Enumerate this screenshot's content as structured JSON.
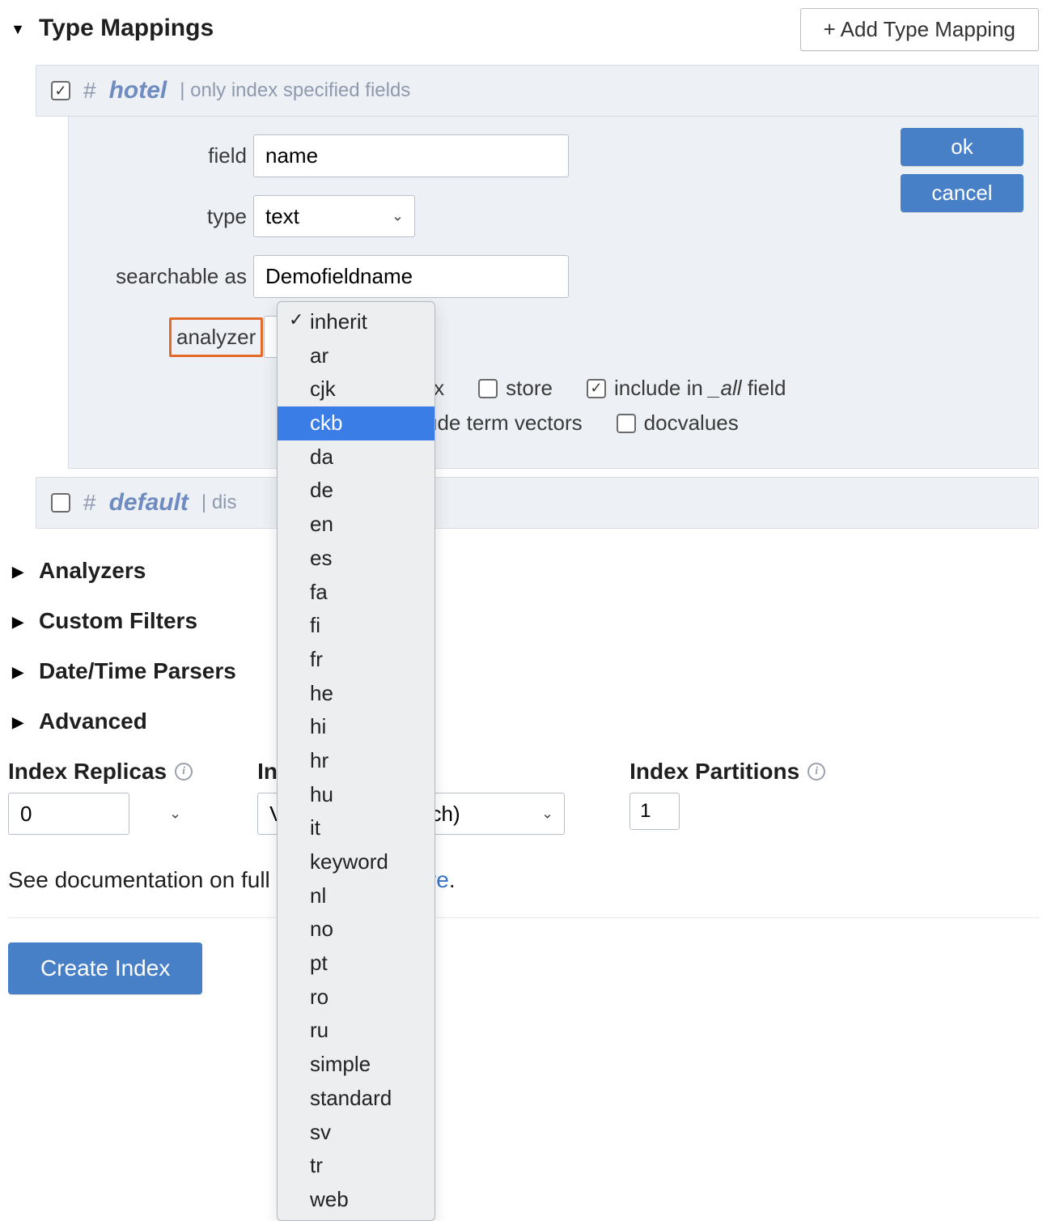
{
  "header": {
    "title": "Type Mappings",
    "add_button": "+ Add Type Mapping"
  },
  "mappings": {
    "hotel": {
      "enabled": true,
      "name": "hotel",
      "note": "| only index specified fields"
    },
    "default": {
      "enabled": false,
      "name": "default",
      "note": "| dis"
    }
  },
  "editor": {
    "labels": {
      "field": "field",
      "type": "type",
      "searchable_as": "searchable as",
      "analyzer": "analyzer"
    },
    "field_value": "name",
    "type_value": "text",
    "searchable_value": "Demofieldname",
    "ok": "ok",
    "cancel": "cancel",
    "options": {
      "index": "index",
      "store": "store",
      "include_prefix": "include in ",
      "include_all": "_all",
      "include_suffix": " field",
      "term_vectors": "include term vectors",
      "docvalues": "docvalues"
    }
  },
  "analyzer_dropdown": {
    "selected": "inherit",
    "highlighted": "ckb",
    "items": [
      "inherit",
      "ar",
      "cjk",
      "ckb",
      "da",
      "de",
      "en",
      "es",
      "fa",
      "fi",
      "fr",
      "he",
      "hi",
      "hr",
      "hu",
      "it",
      "keyword",
      "nl",
      "no",
      "pt",
      "ro",
      "ru",
      "simple",
      "standard",
      "sv",
      "tr",
      "web"
    ]
  },
  "subsections": {
    "analyzers": "Analyzers",
    "custom_filters": "Custom Filters",
    "datetime": "Date/Time Parsers",
    "advanced": "Advanced"
  },
  "index_controls": {
    "replicas_label": "Index Replicas",
    "replicas_value": "0",
    "type_label": "Index Type",
    "type_value": "Version 6.0 (Scorch)",
    "partitions_label": "Index Partitions",
    "partitions_value": "1"
  },
  "doc_line": {
    "prefix": "See documentation on full text indexes ",
    "link": "here",
    "suffix": "."
  },
  "create_button": "Create Index"
}
